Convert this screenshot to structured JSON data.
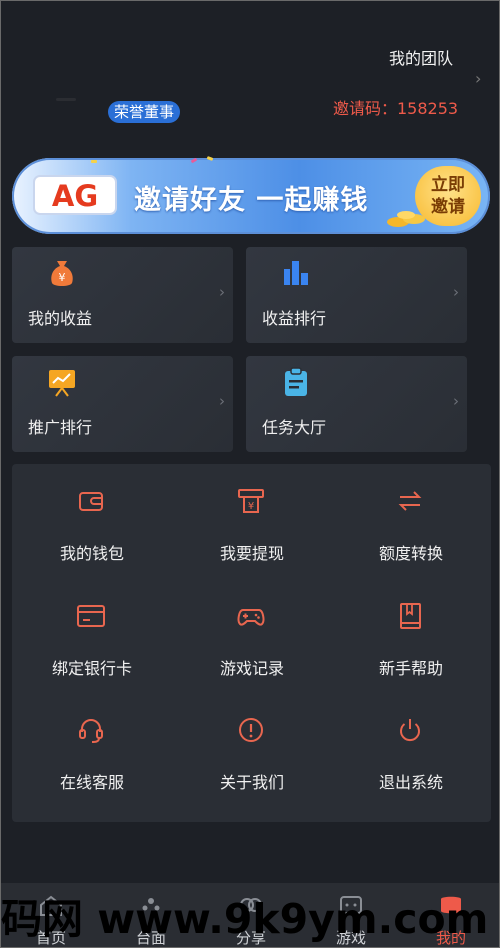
{
  "header": {
    "team_link": "我的团队",
    "chevron": "›",
    "vip_badge": "荣誉董事",
    "invite_label": "邀请码：158253"
  },
  "banner": {
    "logo_text": "AG",
    "headline": "邀请好友 一起赚钱",
    "button_line1": "立即",
    "button_line2": "邀请"
  },
  "cards": [
    {
      "label": "我的收益",
      "icon": "money-bag-icon"
    },
    {
      "label": "收益排行",
      "icon": "bar-chart-icon"
    },
    {
      "label": "推广排行",
      "icon": "presentation-chart-icon"
    },
    {
      "label": "任务大厅",
      "icon": "clipboard-icon"
    }
  ],
  "grid": [
    {
      "label": "我的钱包",
      "icon": "wallet-icon"
    },
    {
      "label": "我要提现",
      "icon": "withdraw-icon"
    },
    {
      "label": "额度转换",
      "icon": "transfer-arrows-icon"
    },
    {
      "label": "绑定银行卡",
      "icon": "bank-card-icon"
    },
    {
      "label": "游戏记录",
      "icon": "gamepad-icon"
    },
    {
      "label": "新手帮助",
      "icon": "book-icon"
    },
    {
      "label": "在线客服",
      "icon": "headset-icon"
    },
    {
      "label": "关于我们",
      "icon": "info-icon"
    },
    {
      "label": "退出系统",
      "icon": "power-icon"
    }
  ],
  "tabs": [
    {
      "label": "首页"
    },
    {
      "label": "台面"
    },
    {
      "label": "分享"
    },
    {
      "label": "游戏"
    },
    {
      "label": "我的"
    }
  ],
  "watermark": "码网 www.9k9ym.com",
  "colors": {
    "accent": "#ee5a4a",
    "card_icon_orange": "#f07a3a",
    "card_icon_blue": "#3a84f0",
    "badge_blue": "#2a6fd6"
  }
}
